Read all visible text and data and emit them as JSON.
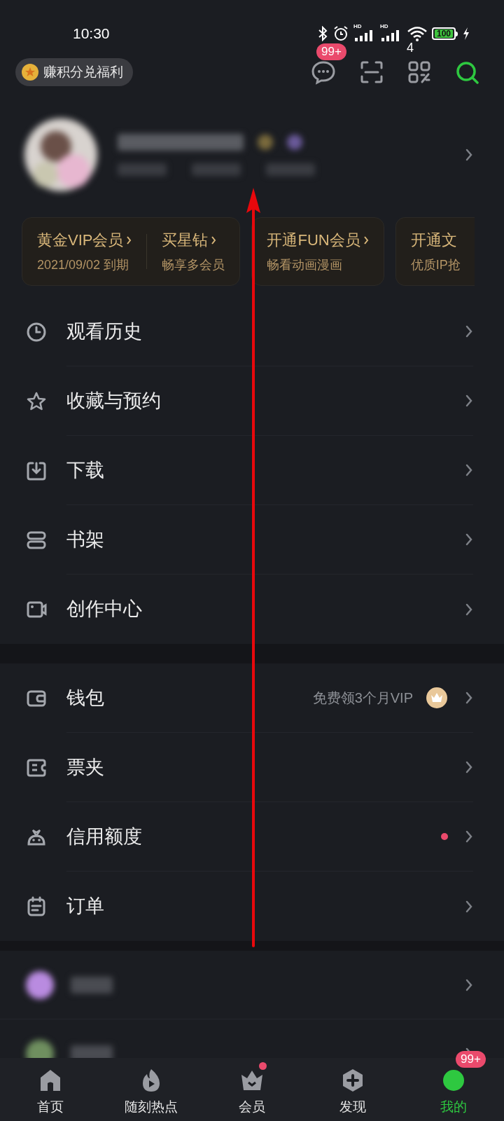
{
  "status_bar": {
    "time": "10:30",
    "hd_labels": [
      "HD",
      "HD"
    ],
    "wifi_label": "4",
    "battery": "100"
  },
  "header": {
    "points_button": "赚积分兑福利",
    "message_badge": "99+"
  },
  "vip_cards": [
    {
      "items": [
        {
          "title": "黄金VIP会员",
          "subtitle": "2021/09/02 到期"
        },
        {
          "title": "买星钻",
          "subtitle": "畅享多会员"
        }
      ]
    },
    {
      "items": [
        {
          "title": "开通FUN会员",
          "subtitle": "畅看动画漫画"
        }
      ]
    },
    {
      "items": [
        {
          "title": "开通文",
          "subtitle": "优质IP抢"
        }
      ]
    }
  ],
  "menu_sections": [
    {
      "items": [
        {
          "label": "观看历史"
        },
        {
          "label": "收藏与预约"
        },
        {
          "label": "下载"
        },
        {
          "label": "书架"
        },
        {
          "label": "创作中心"
        }
      ]
    },
    {
      "items": [
        {
          "label": "钱包",
          "promo": "免费领3个月VIP"
        },
        {
          "label": "票夹"
        },
        {
          "label": "信用额度",
          "dot": true
        },
        {
          "label": "订单"
        }
      ]
    }
  ],
  "blurred_rows": [
    {
      "color": "#b98be0"
    },
    {
      "color": "#6f8f5f"
    }
  ],
  "bottom_nav": [
    {
      "label": "首页",
      "selected": false
    },
    {
      "label": "随刻热点",
      "selected": false
    },
    {
      "label": "会员",
      "selected": false,
      "dot": true
    },
    {
      "label": "发现",
      "selected": false
    },
    {
      "label": "我的",
      "selected": true,
      "badge": "99+"
    }
  ]
}
